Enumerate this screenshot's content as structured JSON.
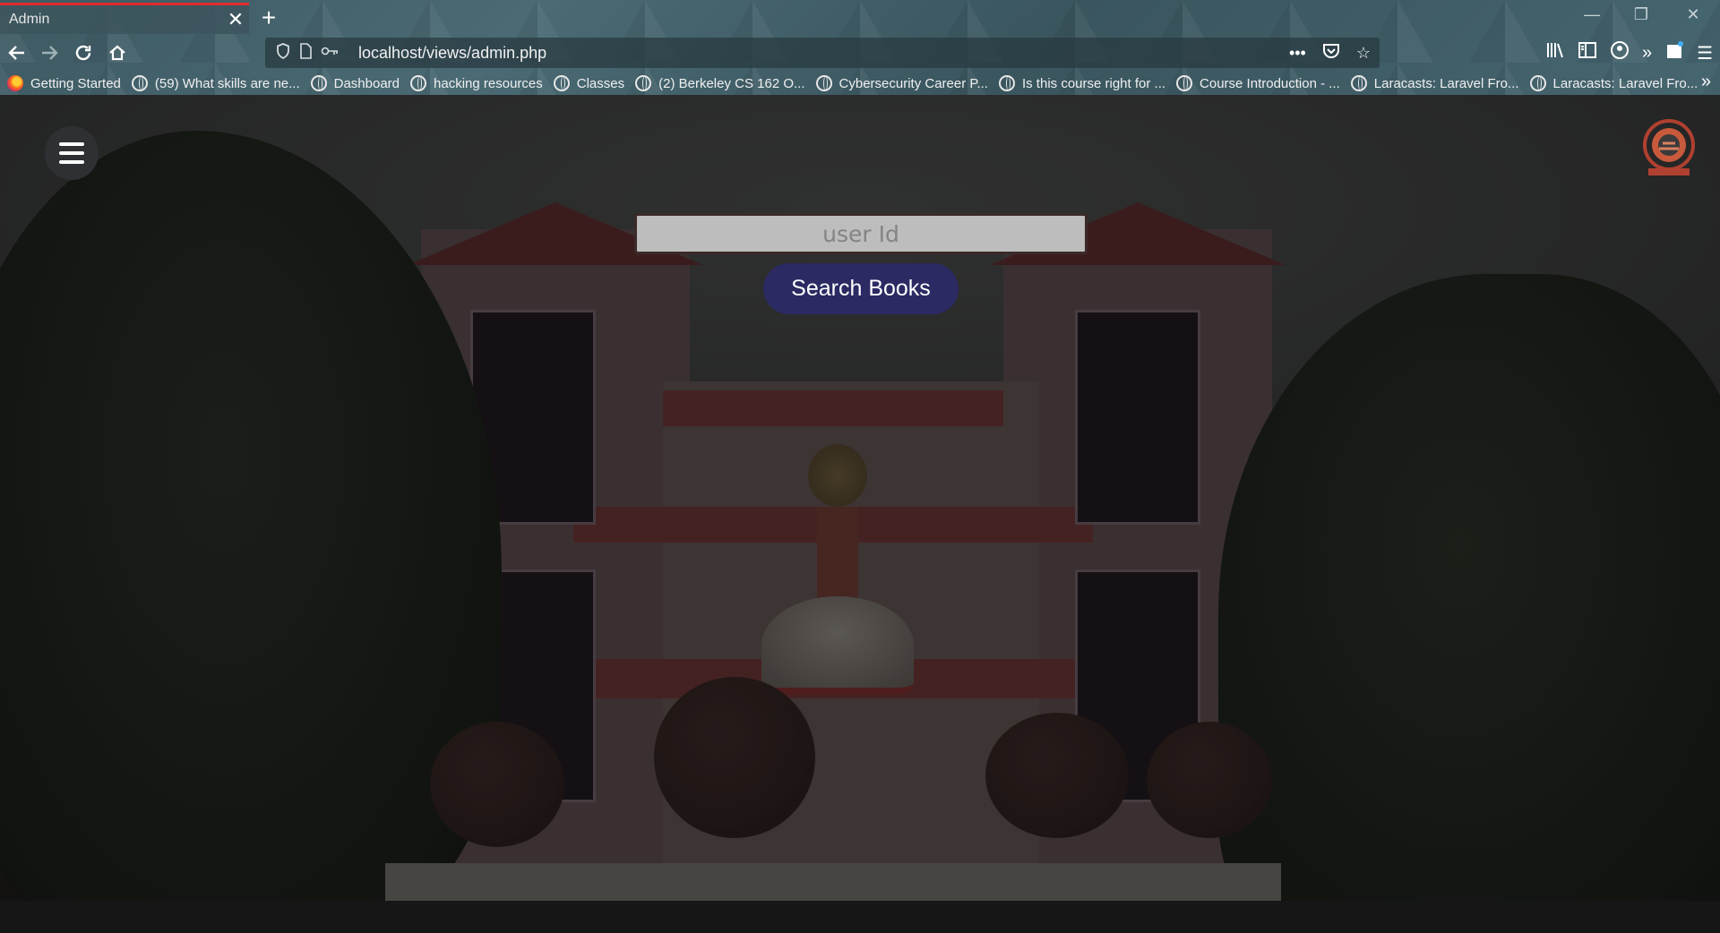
{
  "browser": {
    "tab": {
      "title": "Admin"
    },
    "url": "localhost/views/admin.php",
    "bookmarks": [
      {
        "label": "Getting Started",
        "icon": "firefox-icon"
      },
      {
        "label": "(59) What skills are ne...",
        "icon": "globe-icon"
      },
      {
        "label": "Dashboard",
        "icon": "globe-icon"
      },
      {
        "label": "hacking resources",
        "icon": "globe-icon"
      },
      {
        "label": "Classes",
        "icon": "globe-icon"
      },
      {
        "label": "(2) Berkeley CS 162 O...",
        "icon": "globe-icon"
      },
      {
        "label": "Cybersecurity Career P...",
        "icon": "globe-icon"
      },
      {
        "label": "Is this course right for ...",
        "icon": "globe-icon"
      },
      {
        "label": "Course Introduction - ...",
        "icon": "globe-icon"
      },
      {
        "label": "Laracasts: Laravel Fro...",
        "icon": "globe-icon"
      },
      {
        "label": "Laracasts: Laravel Fro...",
        "icon": "globe-icon"
      }
    ],
    "accent_color": "#e02b2b"
  },
  "page": {
    "search": {
      "placeholder": "user Id",
      "button_label": "Search Books"
    },
    "colors": {
      "button_bg": "#2b2a63",
      "input_bg": "#bdbdbd"
    }
  }
}
